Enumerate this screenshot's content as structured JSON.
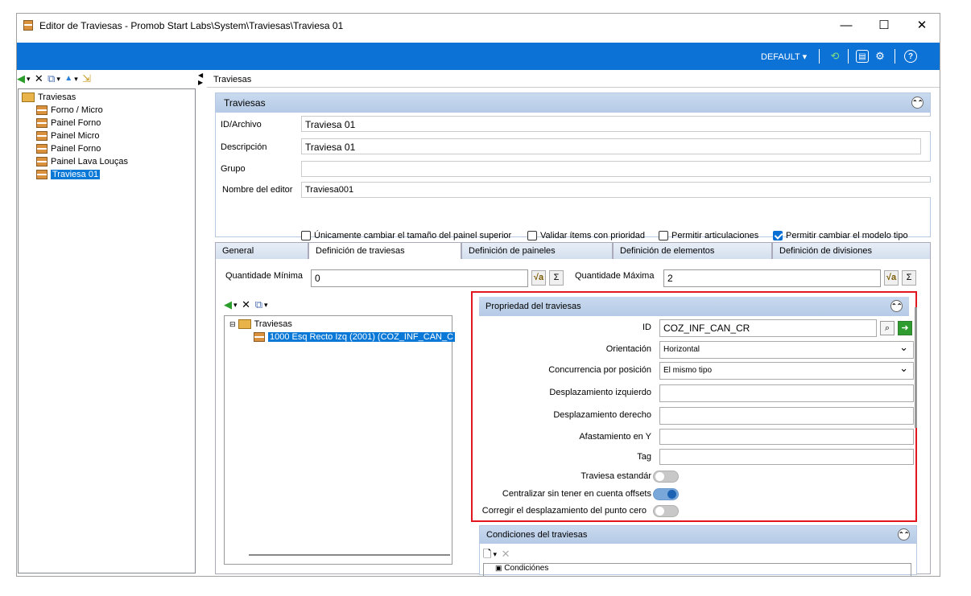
{
  "window": {
    "title": "Editor de Traviesas - Promob Start Labs\\System\\Traviesas\\Traviesa 01",
    "minimize": "—",
    "maximize": "☐",
    "close": "✕"
  },
  "ribbon": {
    "profile_label": "DEFAULT",
    "profile_arrow": "▾",
    "refresh_icon": "refresh-icon",
    "panel_icon": "panel-icon",
    "settings_icon": "gears-icon",
    "help_icon": "help-icon",
    "color": "#0d72d6"
  },
  "left_toolbar": {
    "back": "◀",
    "delete": "✕",
    "copy": "⧉",
    "move_up": "▲",
    "export": "⇲",
    "dropdown": "▾"
  },
  "tree": {
    "root": "Traviesas",
    "items": [
      {
        "label": "Forno / Micro"
      },
      {
        "label": "Painel Forno"
      },
      {
        "label": "Painel Micro"
      },
      {
        "label": "Painel Forno"
      },
      {
        "label": "Painel Lava Louças"
      },
      {
        "label": "Traviesa 01",
        "selected": true
      }
    ]
  },
  "right_header": "Traviesas",
  "group": {
    "title": "Traviesas",
    "fields": [
      {
        "label": "ID/Archivo",
        "value": "Traviesa 01"
      },
      {
        "label": "Descripción",
        "value": "Traviesa 01"
      },
      {
        "label": "Grupo",
        "value": ""
      },
      {
        "label": "Nombre del editor",
        "value": "Traviesa001"
      }
    ],
    "checkboxes": [
      {
        "label": "Únicamente cambiar el tamaño del painel superior",
        "checked": false
      },
      {
        "label": "Validar ítems con prioridad",
        "checked": false
      },
      {
        "label": "Permitir articulaciones",
        "checked": false
      },
      {
        "label": "Permitir cambiar el modelo tipo",
        "checked": true
      }
    ]
  },
  "tabs": [
    "General",
    "Definición de traviesas",
    "Definición de paineles",
    "Definición de elementos",
    "Definición de divisiones"
  ],
  "active_tab": "Definición de traviesas",
  "quantity": {
    "min_label": "Quantidade Mínima",
    "min_value": "0",
    "max_label": "Quantidade Máxima",
    "max_value": "2",
    "sigma": "Σ",
    "formula_icon": "√a"
  },
  "subtree": {
    "root": "Traviesas",
    "item": "1000 Esq Recto Izq (2001) (COZ_INF_CAN_C"
  },
  "properties": {
    "title": "Propriedad del traviesas",
    "id_label": "ID",
    "id_value": "COZ_INF_CAN_CR",
    "orientation_label": "Orientación",
    "orientation_value": "Horizontal",
    "concurrency_label": "Concurrencia por posición",
    "concurrency_value": "El mismo tipo",
    "left_offset_label": "Desplazamiento izquierdo",
    "left_offset_value": "",
    "right_offset_label": "Desplazamiento derecho",
    "right_offset_value": "",
    "y_spacing_label": "Afastamiento en Y",
    "y_spacing_value": "",
    "tag_label": "Tag",
    "tag_value": "",
    "standard_label": "Traviesa estandár",
    "standard_on": false,
    "center_label": "Centralizar sin tener en cuenta offsets",
    "center_on": true,
    "zero_label": "Corregir el desplazamiento del punto cero",
    "zero_on": false,
    "highlight_color": "#e1161f"
  },
  "conditions": {
    "title": "Condiciones del traviesas",
    "item": "Condiciónes"
  }
}
